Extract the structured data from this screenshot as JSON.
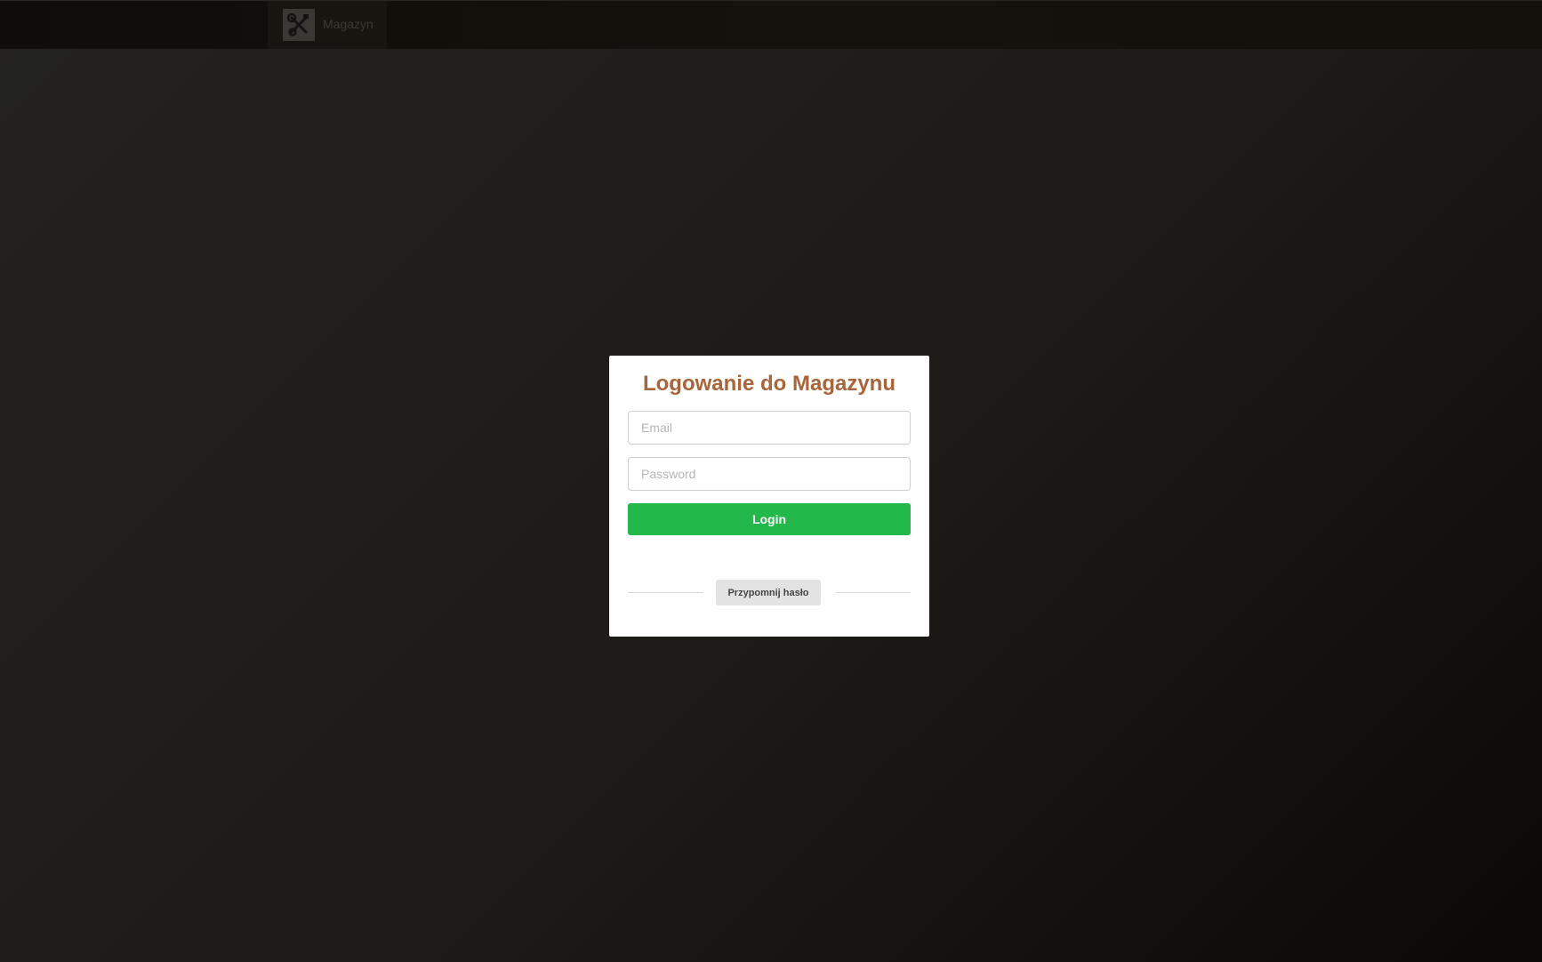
{
  "header": {
    "brand_name": "Magazyn",
    "logo_icon": "tools-icon"
  },
  "login": {
    "title": "Logowanie do Magazynu",
    "email_placeholder": "Email",
    "email_value": "",
    "password_placeholder": "Password",
    "password_value": "",
    "login_label": "Login",
    "remind_label": "Przypomnij hasło"
  },
  "colors": {
    "title": "#a8643a",
    "login_button": "#22b84a",
    "remind_button": "#e3e3e3",
    "background_dark": "#1d1b17"
  }
}
